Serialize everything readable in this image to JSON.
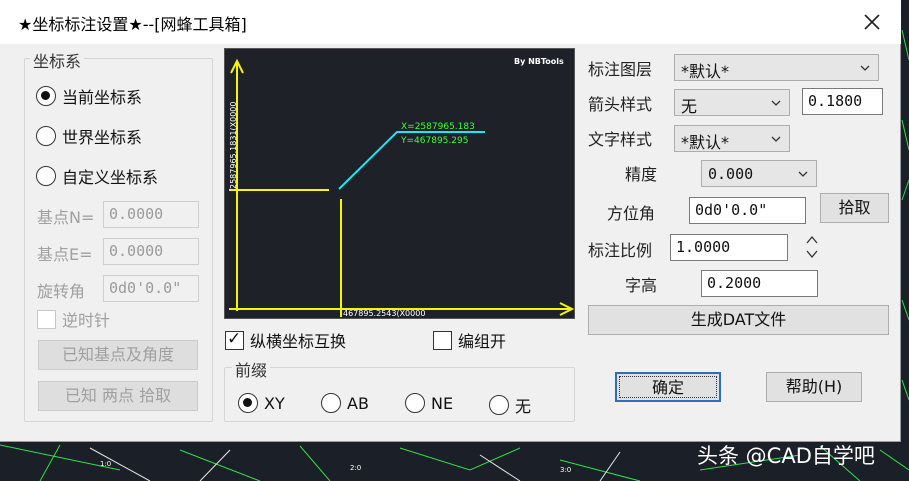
{
  "window": {
    "title": "★坐标标注设置★--[网蜂工具箱]"
  },
  "coord_system": {
    "title": "坐标系",
    "options": [
      "当前坐标系",
      "世界坐标系",
      "自定义坐标系"
    ],
    "selected": "当前坐标系",
    "base_n_label": "基点N=",
    "base_n_value": "0.0000",
    "base_e_label": "基点E=",
    "base_e_value": "0.0000",
    "rotation_label": "旋转角",
    "rotation_value": "0d0'0.0\"",
    "ccw_label": "逆时针",
    "known_base_angle_button": "已知基点及角度",
    "known_two_points_button": "已知 两点 拾取"
  },
  "preview": {
    "brand": "By NBTools",
    "x_value": "X=2587965.183",
    "y_value": "Y=467895.295",
    "vertical_axis_label": "2587965.1831(X0000",
    "horizontal_axis_label": "467895.2543(X0000"
  },
  "options": {
    "swap_label": "纵横坐标互换",
    "swap_checked": true,
    "group_label": "编组开",
    "group_checked": false
  },
  "prefix": {
    "title": "前缀",
    "options": [
      "XY",
      "AB",
      "NE",
      "无"
    ],
    "selected": "XY"
  },
  "settings": {
    "layer_label": "标注图层",
    "layer_value": "*默认*",
    "arrow_label": "箭头样式",
    "arrow_value": "无",
    "arrow_size": "0.1800",
    "text_style_label": "文字样式",
    "text_style_value": "*默认*",
    "precision_label": "精度",
    "precision_value": "0.000",
    "azimuth_label": "方位角",
    "azimuth_value": "0d0'0.0\"",
    "pick_button": "拾取",
    "scale_label": "标注比例",
    "scale_value": "1.0000",
    "height_label": "字高",
    "height_value": "0.2000",
    "generate_button": "生成DAT文件"
  },
  "footer": {
    "ok_button": "确定",
    "help_button": "帮助(H)"
  },
  "watermark": "头条 @CAD自学吧",
  "colors": {
    "preview_axis": "#f5f50a",
    "preview_leader": "#19e8f5",
    "preview_text": "#3cff3c",
    "default_button_border": "#2a6ebd"
  }
}
